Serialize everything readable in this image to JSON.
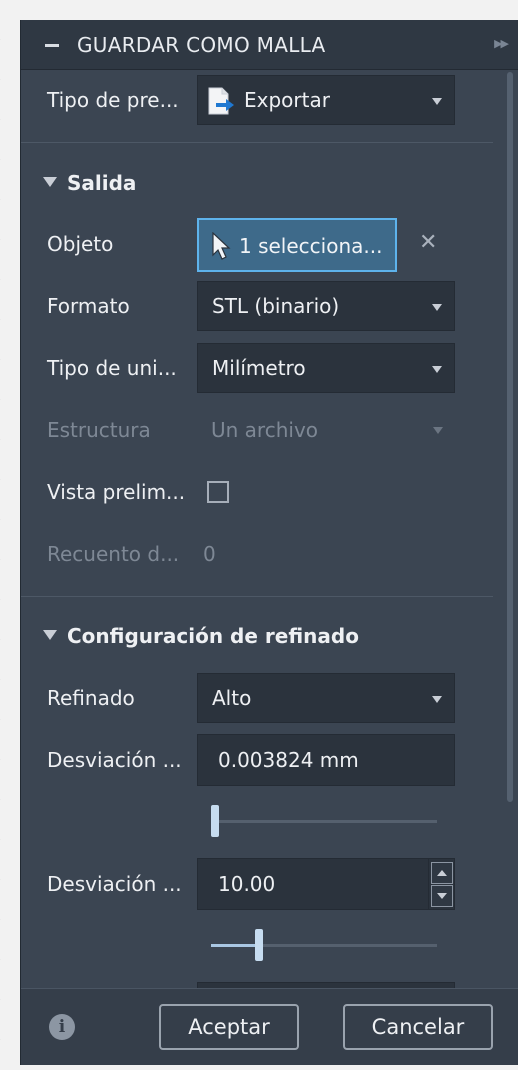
{
  "panel": {
    "title": "GUARDAR COMO MALLA"
  },
  "preset": {
    "label": "Tipo de pre...",
    "value": "Exportar",
    "icon": "export-file-icon"
  },
  "output_section": {
    "title": "Salida",
    "object": {
      "label": "Objeto",
      "value": "1 selecciona...",
      "icon": "cursor-select-icon"
    },
    "format": {
      "label": "Formato",
      "value": "STL (binario)"
    },
    "unit_type": {
      "label": "Tipo de uni...",
      "value": "Milímetro"
    },
    "structure": {
      "label": "Estructura",
      "value": "Un archivo",
      "disabled": true
    },
    "preview": {
      "label": "Vista prelim...",
      "checked": false
    },
    "count": {
      "label": "Recuento d...",
      "value": "0",
      "disabled": true
    }
  },
  "refinement_section": {
    "title": "Configuración de refinado",
    "refinement": {
      "label": "Refinado",
      "value": "Alto"
    },
    "deviation_surface": {
      "label": "Desviación ...",
      "value": "0.003824 mm",
      "slider_fraction": 0.02
    },
    "deviation_normal": {
      "label": "Desviación ...",
      "value": "10.00",
      "slider_fraction": 0.21
    }
  },
  "footer": {
    "accept_label": "Aceptar",
    "cancel_label": "Cancelar"
  },
  "colors": {
    "panel_bg": "#3b4552",
    "field_bg": "#2b333d",
    "selection_border": "#5eb3ec",
    "selection_bg": "#3e6a8a"
  }
}
